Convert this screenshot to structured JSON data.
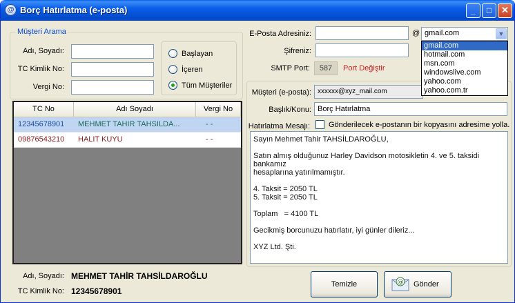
{
  "window": {
    "title": "Borç Hatırlatma (e-posta)",
    "buttons": [
      "_",
      "□",
      "✕"
    ]
  },
  "search": {
    "group_title": "Müşteri Arama",
    "name_label": "Adı, Soyadı:",
    "tc_label": "TC Kimlik No:",
    "tax_label": "Vergi No:",
    "name_value": "",
    "tc_value": "",
    "tax_value": "",
    "options": [
      {
        "label": "Başlayan",
        "selected": false
      },
      {
        "label": "İçeren",
        "selected": false
      },
      {
        "label": "Tüm Müşteriler",
        "selected": true
      }
    ]
  },
  "grid": {
    "columns": [
      "TC No",
      "Adı Soyadı",
      "Vergi No"
    ],
    "rows": [
      {
        "tc": "12345678901",
        "name": "MEHMET TAHIR TAHSILDA...",
        "tax": "-  -",
        "selected": true
      },
      {
        "tc": "09876543210",
        "name": "HALIT KUYU",
        "tax": "-  -",
        "selected": false
      }
    ]
  },
  "selected_customer": {
    "name_label": "Adı, Soyadı:",
    "name_value": "MEHMET TAHİR TAHSİLDAROĞLU",
    "tc_label": "TC Kimlik No:",
    "tc_value": "12345678901"
  },
  "email": {
    "address_label": "E-Posta Adresiniz:",
    "address_value": "",
    "at_sign": "@",
    "domain_selected": "gmail.com",
    "domain_options": [
      "gmail.com",
      "hotmail.com",
      "msn.com",
      "windowslive.com",
      "yahoo.com",
      "yahoo.com.tr"
    ],
    "password_label": "Şifreniz:",
    "password_value": "",
    "smtp_label": "SMTP Port:",
    "smtp_value": "587",
    "port_change": "Port Değiştir"
  },
  "message": {
    "customer_email_label": "Müşteri (e-posta):",
    "customer_email_value": "xxxxxx@xyz_mail.com",
    "subject_label": "Başlık/Konu:",
    "subject_value": "Borç Hatırlatma",
    "body_label": "Hatırlatma Mesajı:",
    "copy_checkbox_label": "Gönderilecek e-postanın bir kopyasını adresime yolla.",
    "copy_checked": false,
    "body": "Sayın Mehmet Tahir TAHSİLDAROĞLU,\n\nSatın almış olduğunuz Harley Davidson motosikletin 4. ve 5. taksidi bankamız\nhesaplarına yatırılmamıştır.\n\n4. Taksit = 2050 TL\n5. Taksit = 2050 TL\n\nToplam   = 4100 TL\n\nGecikmiş borcunuzu hatırlatır, iyi günler dileriz...\n\nXYZ Ltd. Şti."
  },
  "actions": {
    "clear": "Temizle",
    "send": "Gönder"
  }
}
